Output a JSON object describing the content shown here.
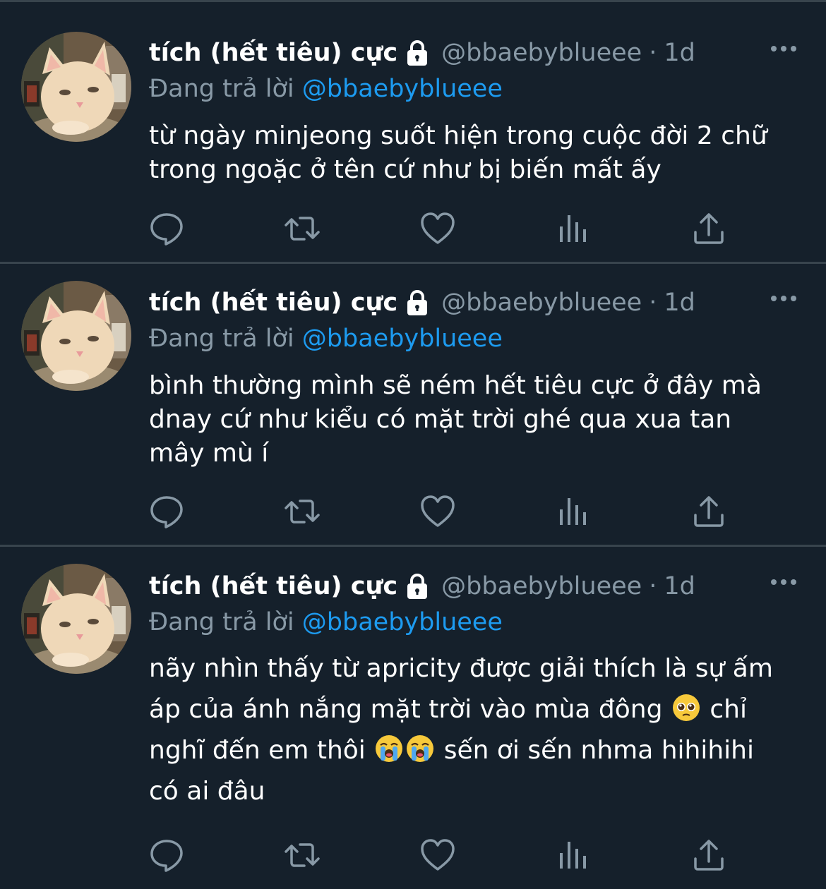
{
  "colors": {
    "background": "#15202b",
    "divider": "#38444d",
    "secondary_text": "#8899a6",
    "mention": "#1d9bf0"
  },
  "tweets": [
    {
      "name": "tích (hết tiêu) cực",
      "handle": "@bbaebyblueee",
      "separator": "·",
      "time": "1d",
      "reply_prefix": "Đang trả lời",
      "reply_to": "@bbaebyblueee",
      "text": "từ ngày minjeong suốt hiện trong cuộc đời 2 chữ\ntrong ngoặc ở tên cứ như bị biến mất ấy"
    },
    {
      "name": "tích (hết tiêu) cực",
      "handle": "@bbaebyblueee",
      "separator": "·",
      "time": "1d",
      "reply_prefix": "Đang trả lời",
      "reply_to": "@bbaebyblueee",
      "text": "bình thường mình sẽ ném hết tiêu cực ở đây mà\ndnay cứ như kiểu có mặt trời ghé qua xua tan\nmây mù í"
    },
    {
      "name": "tích (hết tiêu) cực",
      "handle": "@bbaebyblueee",
      "separator": "·",
      "time": "1d",
      "reply_prefix": "Đang trả lời",
      "reply_to": "@bbaebyblueee",
      "text_line1": "nãy nhìn thấy từ apricity được giải thích là sự ấm",
      "text_line2a": "áp của ánh nắng mặt trời vào mùa đông",
      "text_line2b": " chỉ",
      "text_line3a": "nghĩ đến em thôi",
      "text_line3b": " sến ơi sến nhma hihihihi",
      "text_line4": "có ai đâu"
    }
  ],
  "icons": {
    "avatar": "cat-avatar",
    "lock": "lock-icon",
    "more": "more-icon",
    "reply": "reply-icon",
    "retweet": "retweet-icon",
    "like": "heart-icon",
    "analytics": "analytics-icon",
    "share": "share-icon",
    "emoji_pleading": "pleading-face-emoji",
    "emoji_crying": "loudly-crying-face-emoji"
  }
}
